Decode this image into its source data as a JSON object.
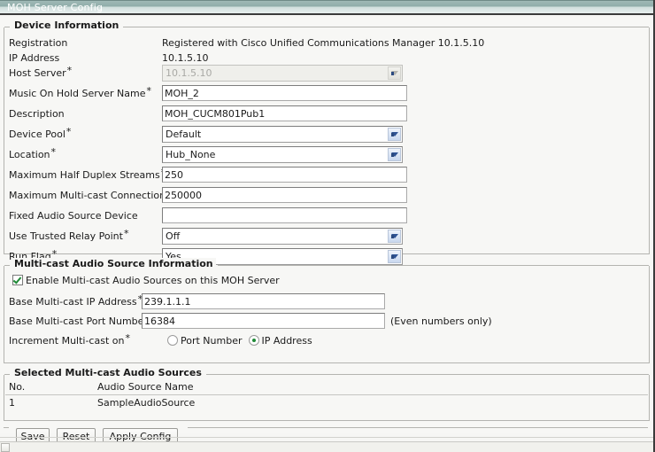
{
  "window": {
    "title": "MOH Server Config"
  },
  "sections": {
    "device_information": {
      "legend": "Device Information",
      "rows": [
        {
          "label": "Registration",
          "required": false,
          "type": "static",
          "value": "Registered with Cisco Unified Communications Manager 10.1.5.10"
        },
        {
          "label": "IP Address",
          "required": false,
          "type": "static",
          "value": "10.1.5.10"
        },
        {
          "label": "Host Server",
          "required": true,
          "type": "select-disabled",
          "value": "10.1.5.10"
        },
        {
          "label": "Music On Hold Server Name",
          "required": true,
          "type": "text",
          "value": "MOH_2"
        },
        {
          "label": "Description",
          "required": false,
          "type": "text",
          "value": "MOH_CUCM801Pub1"
        },
        {
          "label": "Device Pool",
          "required": true,
          "type": "select",
          "value": "Default"
        },
        {
          "label": "Location",
          "required": true,
          "type": "select",
          "value": "Hub_None"
        },
        {
          "label": "Maximum Half Duplex Streams",
          "required": true,
          "type": "text",
          "value": "250"
        },
        {
          "label": "Maximum Multi-cast Connections",
          "required": true,
          "type": "text",
          "value": "250000"
        },
        {
          "label": "Fixed Audio Source Device",
          "required": false,
          "type": "text",
          "value": ""
        },
        {
          "label": "Use Trusted Relay Point",
          "required": true,
          "type": "select",
          "value": "Off"
        },
        {
          "label": "Run Flag",
          "required": true,
          "type": "select",
          "value": "Yes"
        }
      ]
    },
    "multicast_audio": {
      "legend": "Multi-cast Audio Source Information",
      "enable_checkbox": {
        "label": "Enable Multi-cast Audio Sources on this MOH Server",
        "checked": true
      },
      "base_ip": {
        "label": "Base Multi-cast IP Address",
        "required": true,
        "value": "239.1.1.1"
      },
      "base_port": {
        "label": "Base Multi-cast Port Number",
        "required": true,
        "value": "16384",
        "hint": "(Even numbers only)"
      },
      "increment_on": {
        "label": "Increment Multi-cast on",
        "required": true,
        "options": [
          {
            "label": "Port Number",
            "selected": false
          },
          {
            "label": "IP Address",
            "selected": true
          }
        ]
      }
    },
    "selected_sources": {
      "legend": "Selected Multi-cast Audio Sources",
      "columns": [
        "No.",
        "Audio Source Name"
      ],
      "rows": [
        {
          "no": "1",
          "name": "SampleAudioSource"
        }
      ]
    }
  },
  "buttons": {
    "save": "Save",
    "reset": "Reset",
    "apply_config": "Apply Config"
  },
  "colors": {
    "titlebar_accent": "#8fada9",
    "check_green": "#1f8a36",
    "chevron_blue": "#2f5394"
  }
}
